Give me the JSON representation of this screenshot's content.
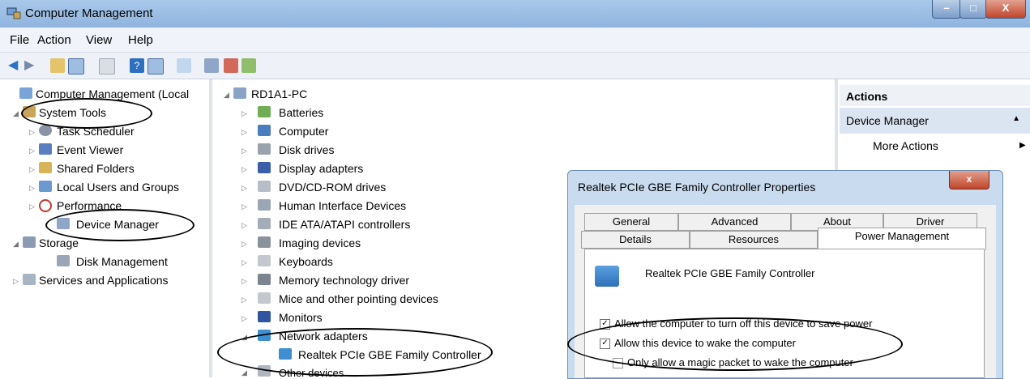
{
  "window": {
    "title": "Computer Management"
  },
  "menu": [
    "File",
    "Action",
    "View",
    "Help"
  ],
  "left_tree": {
    "root": "Computer Management (Local",
    "system_tools": "System Tools",
    "task_scheduler": "Task Scheduler",
    "event_viewer": "Event Viewer",
    "shared_folders": "Shared Folders",
    "local_users": "Local Users and Groups",
    "performance": "Performance",
    "device_manager": "Device Manager",
    "storage": "Storage",
    "disk_management": "Disk Management",
    "services": "Services and Applications"
  },
  "device_tree": {
    "root": "RD1A1-PC",
    "items": [
      "Batteries",
      "Computer",
      "Disk drives",
      "Display adapters",
      "DVD/CD-ROM drives",
      "Human Interface Devices",
      "IDE ATA/ATAPI controllers",
      "Imaging devices",
      "Keyboards",
      "Memory technology driver",
      "Mice and other pointing devices",
      "Monitors",
      "Network adapters"
    ],
    "network_child": "Realtek PCIe GBE Family Controller",
    "other": "Other devices"
  },
  "actions": {
    "header": "Actions",
    "device_manager": "Device Manager",
    "more_actions": "More Actions"
  },
  "dialog": {
    "title": "Realtek PCIe GBE Family Controller  Properties",
    "close": "x",
    "tabs_row1": [
      "General",
      "Advanced",
      "About",
      "Driver"
    ],
    "tabs_row2": [
      "Details",
      "Resources",
      "Power Management"
    ],
    "device_name": "Realtek PCIe GBE Family Controller",
    "options": [
      {
        "label": "Allow the computer to turn off this device to save power",
        "checked": true
      },
      {
        "label": "Allow this device to wake the computer",
        "checked": true
      },
      {
        "label": "Only allow a magic packet to wake the computer",
        "checked": false
      }
    ]
  }
}
